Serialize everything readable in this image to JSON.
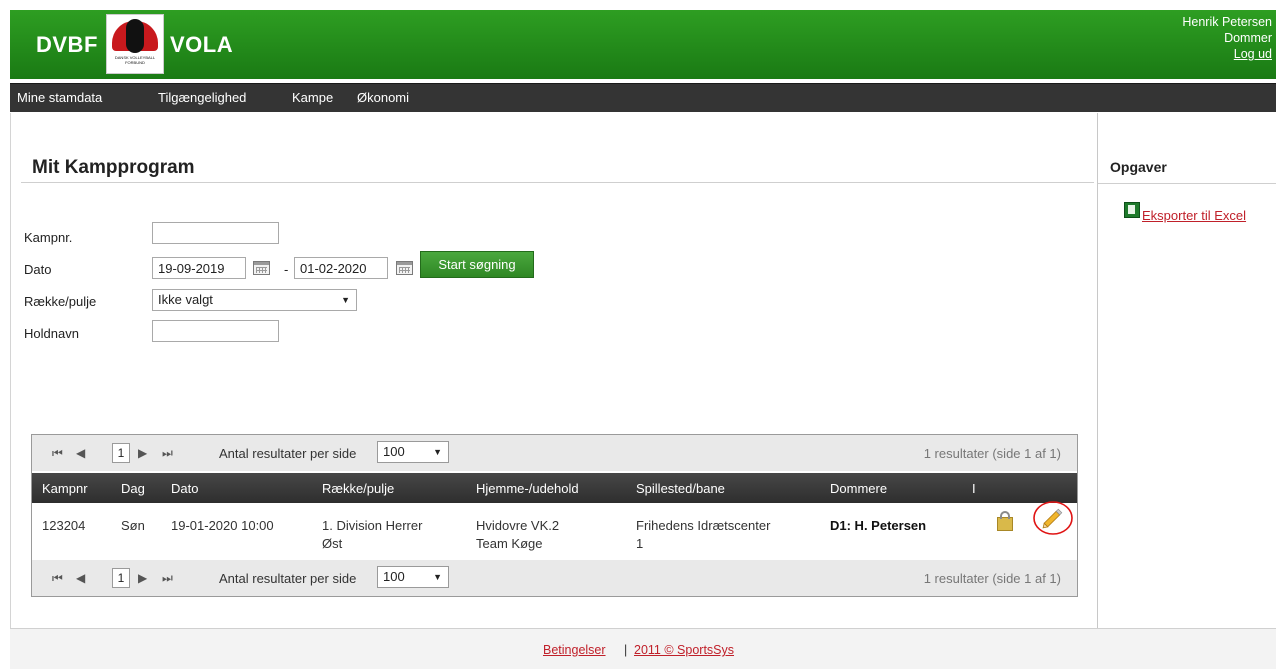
{
  "header": {
    "logo_left": "DVBF",
    "logo_right": "VOLA",
    "badge_text": "DANSK VOLLEYBALL FORBUND",
    "user_name": "Henrik Petersen",
    "user_role": "Dommer",
    "logout_label": "Log ud"
  },
  "nav": {
    "items": [
      "Mine stamdata",
      "Tilgængelighed",
      "Kampe",
      "Økonomi"
    ]
  },
  "page": {
    "title": "Mit Kampprogram"
  },
  "sidebar": {
    "title": "Opgaver",
    "export_label": "Eksporter til Excel"
  },
  "form": {
    "kampnr_label": "Kampnr.",
    "kampnr_value": "",
    "dato_label": "Dato",
    "date_from": "19-09-2019",
    "date_sep": "-",
    "date_to": "01-02-2020",
    "raekke_label": "Række/pulje",
    "raekke_value": "Ikke valgt",
    "holdnavn_label": "Holdnavn",
    "holdnavn_value": "",
    "search_button": "Start søgning"
  },
  "grid": {
    "pager": {
      "first": "⏮",
      "prev": "◀",
      "page": "1",
      "next": "▶",
      "last": "⏭",
      "page_size_label": "Antal resultater per side",
      "page_size": "100",
      "info": "1 resultater (side 1 af 1)"
    },
    "columns": [
      "Kampnr",
      "Dag",
      "Dato",
      "Række/pulje",
      "Hjemme-/udehold",
      "Spillested/bane",
      "Dommere",
      "I"
    ],
    "rows": [
      {
        "kampnr": "123204",
        "dag": "Søn",
        "dato": "19-01-2020 10:00",
        "raekke_line1": "1. Division Herrer",
        "raekke_line2": "Øst",
        "hold_line1": "Hvidovre VK.2",
        "hold_line2": "Team Køge",
        "sted_line1": "Frihedens Idrætscenter",
        "sted_line2": "1",
        "dommere": "D1: H. Petersen",
        "lock_icon": "lock-icon",
        "edit_icon": "pencil-icon"
      }
    ]
  },
  "footer": {
    "terms": "Betingelser",
    "sep": "|",
    "copyright": "2011 © SportsSys"
  },
  "colors": {
    "header_green": "#1f8519",
    "nav_dark": "#343434",
    "link_red": "#c0202a",
    "annotation_red": "#e01414"
  }
}
